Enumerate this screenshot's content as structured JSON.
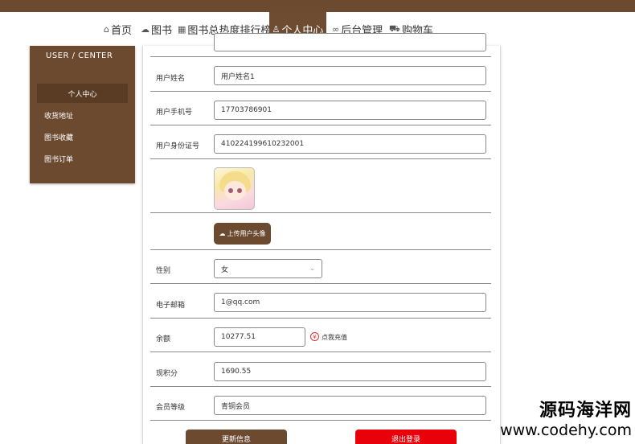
{
  "nav": {
    "items": [
      {
        "label": "首页",
        "icon": "home-icon"
      },
      {
        "label": "图书",
        "icon": "cloud-icon"
      },
      {
        "label": "图书总热度排行榜",
        "icon": "bars-icon"
      },
      {
        "label": "个人中心",
        "icon": "user-icon",
        "active": true
      },
      {
        "label": "后台管理",
        "icon": "link-icon"
      },
      {
        "label": "购物车",
        "icon": "cart-icon"
      }
    ]
  },
  "sidebar": {
    "title": "USER / CENTER",
    "active_label": "个人中心",
    "items": [
      "收货地址",
      "图书收藏",
      "图书订单"
    ]
  },
  "form": {
    "name_label": "用户姓名",
    "name_value": "用户姓名1",
    "phone_label": "用户手机号",
    "phone_value": "17703786901",
    "idcard_label": "用户身份证号",
    "idcard_value": "410224199610232001",
    "upload_label": "上传用户头像",
    "gender_label": "性别",
    "gender_value": "女",
    "email_label": "电子邮箱",
    "email_value": "1@qq.com",
    "balance_label": "余额",
    "balance_value": "10277.51",
    "recharge_label": "点我充值",
    "points_label": "现积分",
    "points_value": "1690.55",
    "level_label": "会员等级",
    "level_value": "青铜会员",
    "update_button": "更新信息",
    "logout_button": "退出登录"
  },
  "watermark": {
    "cn": "源码海洋网",
    "url": "www.codehy.com"
  },
  "colors": {
    "brand_brown": "#6b4a30",
    "logout_red": "#e8000a"
  }
}
